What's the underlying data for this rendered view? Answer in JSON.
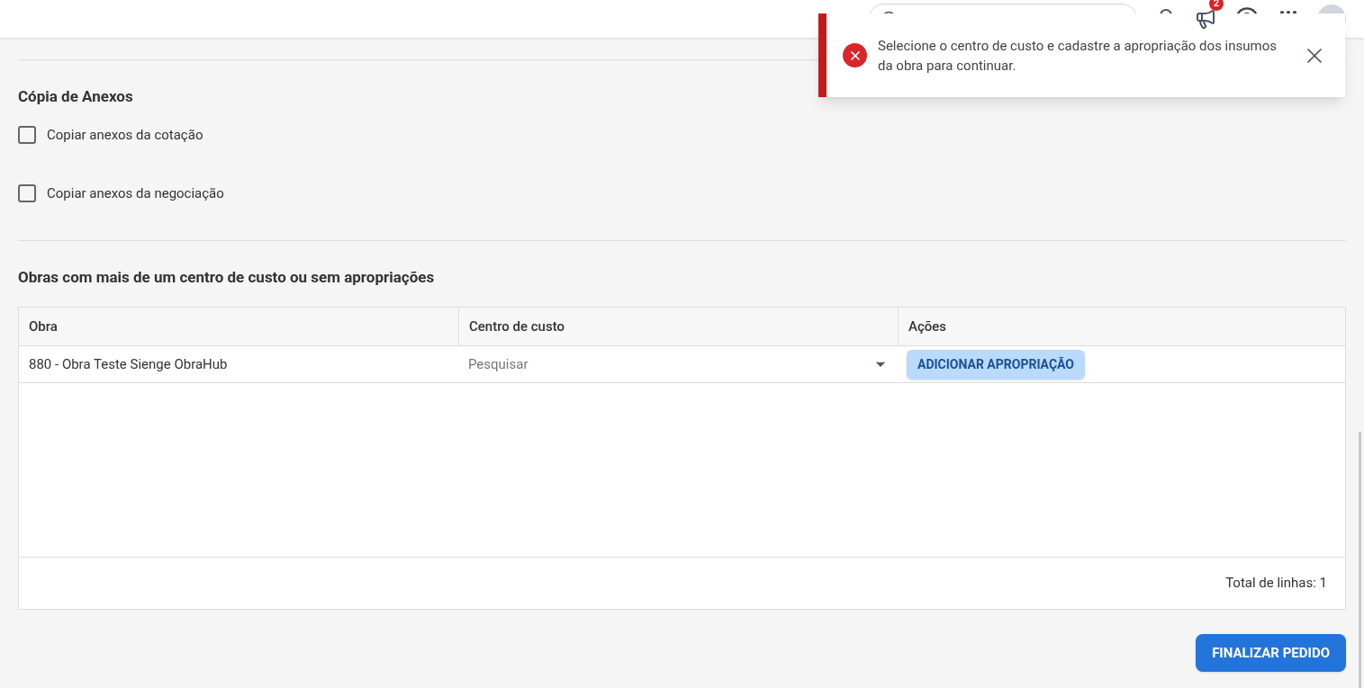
{
  "header": {
    "notification_badge": "2"
  },
  "toast": {
    "message": "Selecione o centro de custo e cadastre a apropriação dos insumos da obra para continuar."
  },
  "attachments": {
    "title": "Cópia de Anexos",
    "options": [
      {
        "label": "Copiar anexos da cotação",
        "checked": false
      },
      {
        "label": "Copiar anexos da negociação",
        "checked": false
      }
    ]
  },
  "works": {
    "title": "Obras com mais de um centro de custo ou sem apropriações",
    "table": {
      "columns": [
        "Obra",
        "Centro de custo",
        "Ações"
      ],
      "rows": [
        {
          "obra": "880 - Obra Teste Sienge ObraHub",
          "cost_center_placeholder": "Pesquisar",
          "action": "ADICIONAR APROPRIAÇÃO"
        }
      ]
    },
    "total": "Total de linhas: 1"
  },
  "finish_button": "FINALIZAR PEDIDO"
}
